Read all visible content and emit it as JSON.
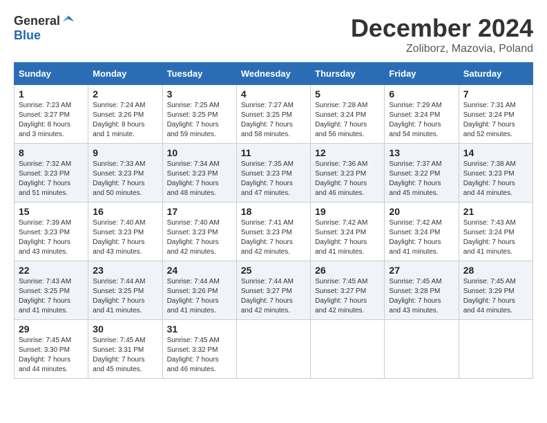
{
  "header": {
    "logo_general": "General",
    "logo_blue": "Blue",
    "month_title": "December 2024",
    "location": "Zoliborz, Mazovia, Poland"
  },
  "calendar": {
    "days_of_week": [
      "Sunday",
      "Monday",
      "Tuesday",
      "Wednesday",
      "Thursday",
      "Friday",
      "Saturday"
    ],
    "weeks": [
      [
        {
          "day": 1,
          "sunrise": "7:23 AM",
          "sunset": "3:27 PM",
          "daylight": "8 hours and 3 minutes"
        },
        {
          "day": 2,
          "sunrise": "7:24 AM",
          "sunset": "3:26 PM",
          "daylight": "8 hours and 1 minute"
        },
        {
          "day": 3,
          "sunrise": "7:25 AM",
          "sunset": "3:25 PM",
          "daylight": "7 hours and 59 minutes"
        },
        {
          "day": 4,
          "sunrise": "7:27 AM",
          "sunset": "3:25 PM",
          "daylight": "7 hours and 58 minutes"
        },
        {
          "day": 5,
          "sunrise": "7:28 AM",
          "sunset": "3:24 PM",
          "daylight": "7 hours and 56 minutes"
        },
        {
          "day": 6,
          "sunrise": "7:29 AM",
          "sunset": "3:24 PM",
          "daylight": "7 hours and 54 minutes"
        },
        {
          "day": 7,
          "sunrise": "7:31 AM",
          "sunset": "3:24 PM",
          "daylight": "7 hours and 52 minutes"
        }
      ],
      [
        {
          "day": 8,
          "sunrise": "7:32 AM",
          "sunset": "3:23 PM",
          "daylight": "7 hours and 51 minutes"
        },
        {
          "day": 9,
          "sunrise": "7:33 AM",
          "sunset": "3:23 PM",
          "daylight": "7 hours and 50 minutes"
        },
        {
          "day": 10,
          "sunrise": "7:34 AM",
          "sunset": "3:23 PM",
          "daylight": "7 hours and 48 minutes"
        },
        {
          "day": 11,
          "sunrise": "7:35 AM",
          "sunset": "3:23 PM",
          "daylight": "7 hours and 47 minutes"
        },
        {
          "day": 12,
          "sunrise": "7:36 AM",
          "sunset": "3:23 PM",
          "daylight": "7 hours and 46 minutes"
        },
        {
          "day": 13,
          "sunrise": "7:37 AM",
          "sunset": "3:22 PM",
          "daylight": "7 hours and 45 minutes"
        },
        {
          "day": 14,
          "sunrise": "7:38 AM",
          "sunset": "3:23 PM",
          "daylight": "7 hours and 44 minutes"
        }
      ],
      [
        {
          "day": 15,
          "sunrise": "7:39 AM",
          "sunset": "3:23 PM",
          "daylight": "7 hours and 43 minutes"
        },
        {
          "day": 16,
          "sunrise": "7:40 AM",
          "sunset": "3:23 PM",
          "daylight": "7 hours and 43 minutes"
        },
        {
          "day": 17,
          "sunrise": "7:40 AM",
          "sunset": "3:23 PM",
          "daylight": "7 hours and 42 minutes"
        },
        {
          "day": 18,
          "sunrise": "7:41 AM",
          "sunset": "3:23 PM",
          "daylight": "7 hours and 42 minutes"
        },
        {
          "day": 19,
          "sunrise": "7:42 AM",
          "sunset": "3:24 PM",
          "daylight": "7 hours and 41 minutes"
        },
        {
          "day": 20,
          "sunrise": "7:42 AM",
          "sunset": "3:24 PM",
          "daylight": "7 hours and 41 minutes"
        },
        {
          "day": 21,
          "sunrise": "7:43 AM",
          "sunset": "3:24 PM",
          "daylight": "7 hours and 41 minutes"
        }
      ],
      [
        {
          "day": 22,
          "sunrise": "7:43 AM",
          "sunset": "3:25 PM",
          "daylight": "7 hours and 41 minutes"
        },
        {
          "day": 23,
          "sunrise": "7:44 AM",
          "sunset": "3:25 PM",
          "daylight": "7 hours and 41 minutes"
        },
        {
          "day": 24,
          "sunrise": "7:44 AM",
          "sunset": "3:26 PM",
          "daylight": "7 hours and 41 minutes"
        },
        {
          "day": 25,
          "sunrise": "7:44 AM",
          "sunset": "3:27 PM",
          "daylight": "7 hours and 42 minutes"
        },
        {
          "day": 26,
          "sunrise": "7:45 AM",
          "sunset": "3:27 PM",
          "daylight": "7 hours and 42 minutes"
        },
        {
          "day": 27,
          "sunrise": "7:45 AM",
          "sunset": "3:28 PM",
          "daylight": "7 hours and 43 minutes"
        },
        {
          "day": 28,
          "sunrise": "7:45 AM",
          "sunset": "3:29 PM",
          "daylight": "7 hours and 44 minutes"
        }
      ],
      [
        {
          "day": 29,
          "sunrise": "7:45 AM",
          "sunset": "3:30 PM",
          "daylight": "7 hours and 44 minutes"
        },
        {
          "day": 30,
          "sunrise": "7:45 AM",
          "sunset": "3:31 PM",
          "daylight": "7 hours and 45 minutes"
        },
        {
          "day": 31,
          "sunrise": "7:45 AM",
          "sunset": "3:32 PM",
          "daylight": "7 hours and 46 minutes"
        },
        null,
        null,
        null,
        null
      ]
    ]
  }
}
